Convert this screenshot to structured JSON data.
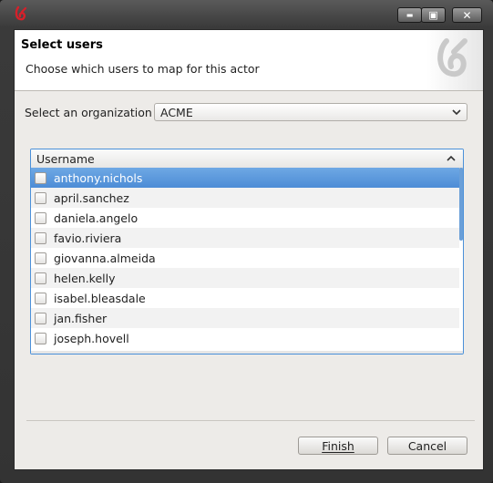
{
  "titlebar": {
    "logo_icon": "bonita-logo-icon",
    "controls": [
      "minimize-icon",
      "maximize-icon",
      "close-icon"
    ],
    "minimize_glyph": "▬",
    "maximize_glyph": "▣",
    "close_glyph": "✕"
  },
  "header": {
    "title": "Select users",
    "description": "Choose which users to map for this actor",
    "logo_icon": "bonita-logo-icon"
  },
  "organization": {
    "label": "Select an organization",
    "selected": "ACME"
  },
  "table": {
    "column": "Username",
    "rows": [
      "anthony.nichols",
      "april.sanchez",
      "daniela.angelo",
      "favio.riviera",
      "giovanna.almeida",
      "helen.kelly",
      "isabel.bleasdale",
      "jan.fisher",
      "joseph.hovell"
    ],
    "selected_index": 0
  },
  "buttons": {
    "finish": "Finish",
    "cancel": "Cancel"
  },
  "colors": {
    "accent": "#4d8cd6",
    "logo_red": "#d6202a"
  }
}
